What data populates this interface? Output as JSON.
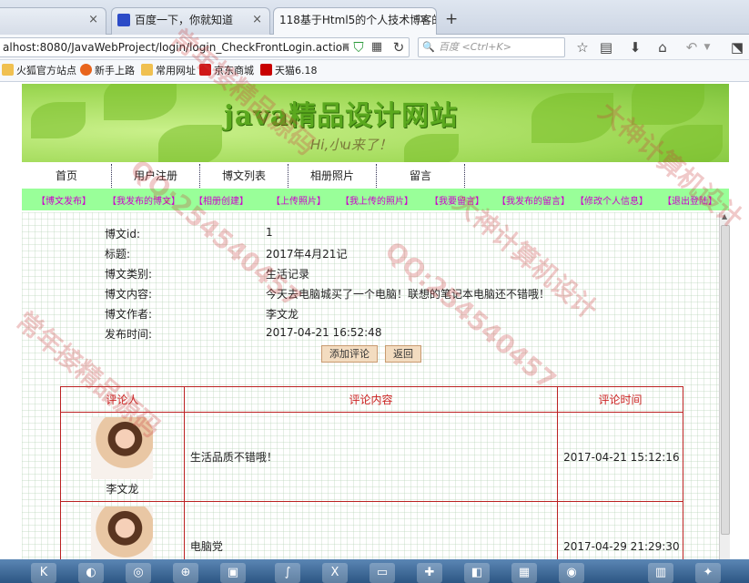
{
  "browser": {
    "tabs": [
      {
        "label": ""
      },
      {
        "label": "百度一下，你就知道"
      },
      {
        "label": "118基于Html5的个人技术博客的"
      }
    ],
    "new_tab": "+",
    "close": "×",
    "url": "alhost:8080/JavaWebProject/login/login_CheckFrontLogin.action",
    "search_placeholder": "百度 <Ctrl+K>",
    "bookmarks": [
      "火狐官方站点",
      "新手上路",
      "常用网址",
      "京东商城",
      "天猫6.18"
    ]
  },
  "site": {
    "title": "java精品设计网站",
    "subtitle": "Hi,小u来了！",
    "main_nav": [
      "首页",
      "用户注册",
      "博文列表",
      "相册照片",
      "留言"
    ],
    "sub_nav": [
      "【博文发布】",
      "【我发布的博文】",
      "【相册创建】",
      "【上传照片】",
      "【我上传的照片】",
      "【我要留言】",
      "【我发布的留言】",
      "【修改个人信息】",
      "【退出登陆】"
    ]
  },
  "blog": {
    "fields": [
      {
        "label": "博文id:",
        "value": "1"
      },
      {
        "label": "标题:",
        "value": "2017年4月21记"
      },
      {
        "label": "博文类别:",
        "value": "生活记录"
      },
      {
        "label": "博文内容:",
        "value": "今天去电脑城买了一个电脑！联想的笔记本电脑还不错哦！"
      },
      {
        "label": "博文作者:",
        "value": "李文龙"
      },
      {
        "label": "发布时间:",
        "value": "2017-04-21 16:52:48"
      }
    ],
    "add_comment": "添加评论",
    "back": "返回"
  },
  "comments": {
    "headers": [
      "评论人",
      "评论内容",
      "评论时间"
    ],
    "rows": [
      {
        "user": "李文龙",
        "content": "生活品质不错哦！",
        "time": "2017-04-21 15:12:16"
      },
      {
        "user": "",
        "content": "电脑党",
        "time": "2017-04-29 21:29:30"
      }
    ]
  },
  "watermarks": [
    "大神计算机设计",
    "QQ:254540457",
    "常年接精品源码"
  ],
  "colors": {
    "subnav_bg": "#99ff99",
    "subnav_text": "#cc00cc",
    "table_border": "#bb2222",
    "button_bg": "#f3dcc0"
  }
}
